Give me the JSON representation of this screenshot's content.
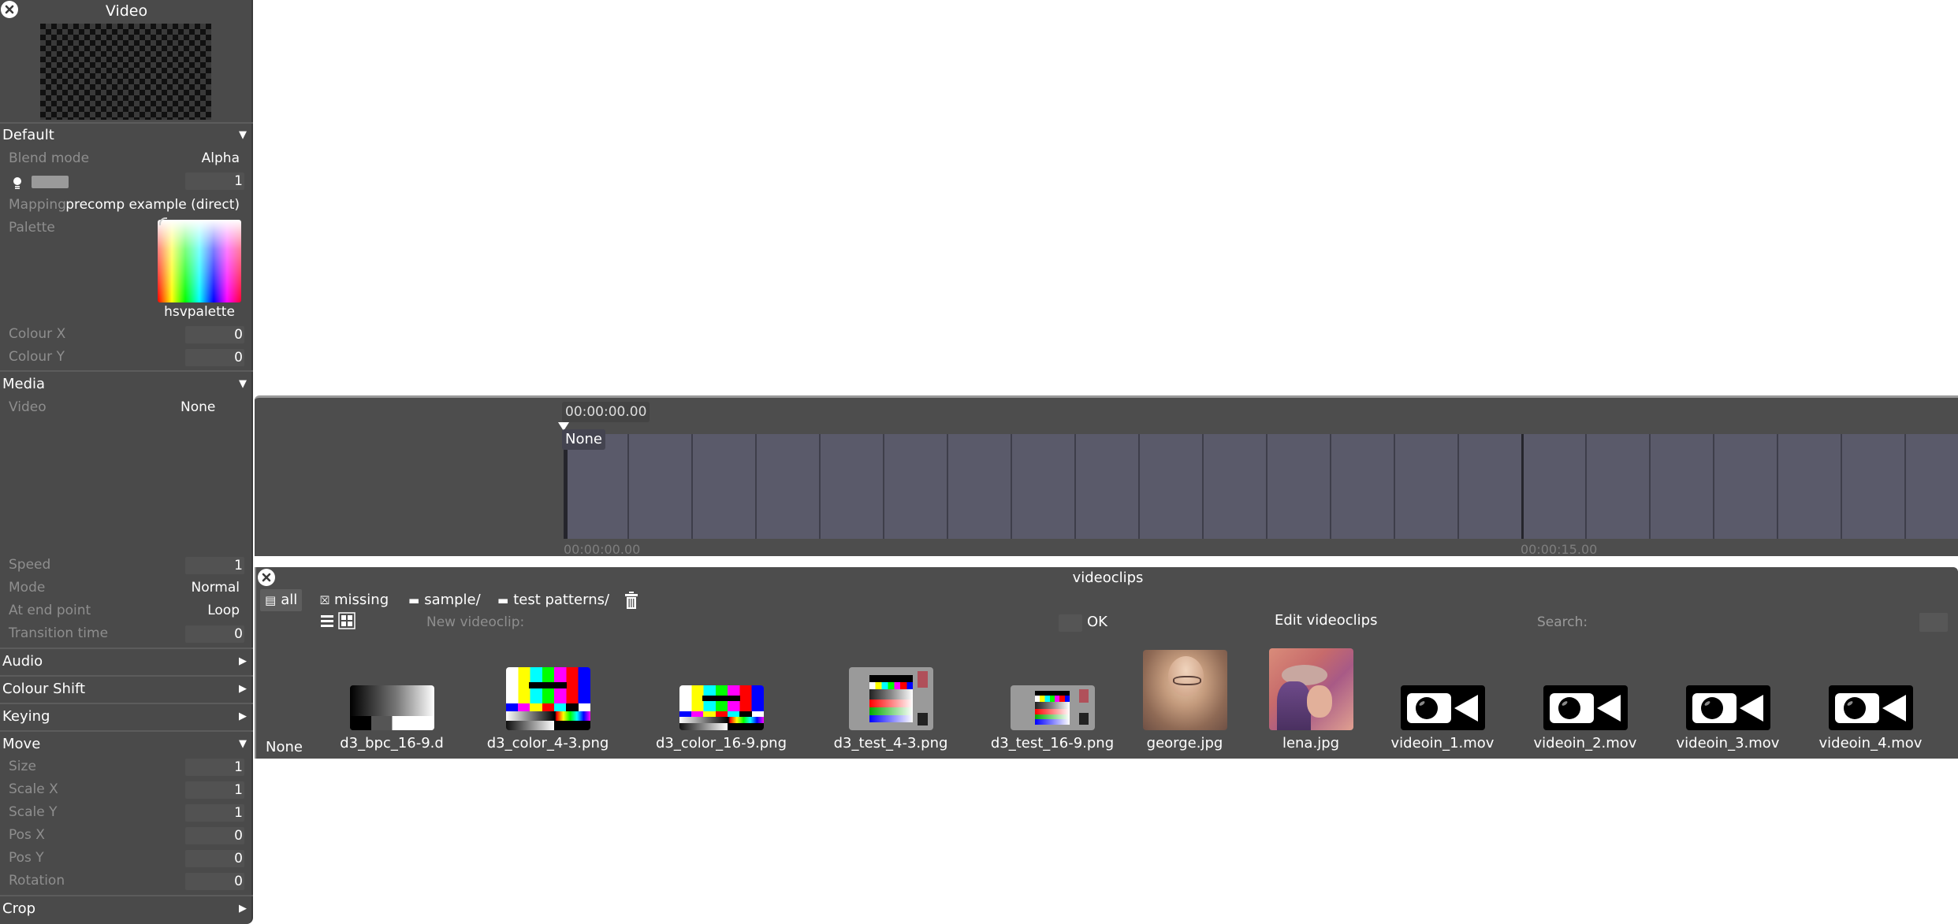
{
  "left_panel": {
    "title": "Video",
    "sections": {
      "default": {
        "label": "Default",
        "expanded": true,
        "blend_mode_label": "Blend mode",
        "blend_mode_value": "Alpha",
        "opacity_value": "1",
        "mapping_label": "Mapping",
        "mapping_value": "precomp example (direct)",
        "palette_label": "Palette",
        "palette_name": "hsvpalette",
        "colour_x_label": "Colour X",
        "colour_x_value": "0",
        "colour_y_label": "Colour Y",
        "colour_y_value": "0"
      },
      "media": {
        "label": "Media",
        "expanded": true,
        "video_label": "Video",
        "video_value": "None",
        "speed_label": "Speed",
        "speed_value": "1",
        "mode_label": "Mode",
        "mode_value": "Normal",
        "end_point_label": "At end point",
        "end_point_value": "Loop",
        "transition_label": "Transition time",
        "transition_value": "0"
      },
      "audio": {
        "label": "Audio",
        "expanded": false
      },
      "colour_shift": {
        "label": "Colour Shift",
        "expanded": false
      },
      "keying": {
        "label": "Keying",
        "expanded": false
      },
      "move": {
        "label": "Move",
        "expanded": true,
        "size_label": "Size",
        "size_value": "1",
        "scale_x_label": "Scale X",
        "scale_x_value": "1",
        "scale_y_label": "Scale Y",
        "scale_y_value": "1",
        "pos_x_label": "Pos X",
        "pos_x_value": "0",
        "pos_y_label": "Pos Y",
        "pos_y_value": "0",
        "rotation_label": "Rotation",
        "rotation_value": "0"
      },
      "crop": {
        "label": "Crop",
        "expanded": false
      }
    }
  },
  "timeline": {
    "current_time": "00:00:00.00",
    "clip_label": "None",
    "start_time": "00:00:00.00",
    "marker_time": "00:00:15.00"
  },
  "videoclips": {
    "title": "videoclips",
    "filters": [
      {
        "label": "all",
        "icon": "list-icon",
        "active": true
      },
      {
        "label": "missing",
        "icon": "missing-icon",
        "active": false
      },
      {
        "label": "sample/",
        "icon": "folder-icon",
        "active": false
      },
      {
        "label": "test patterns/",
        "icon": "folder-icon",
        "active": false
      }
    ],
    "new_clip_label": "New videoclip:",
    "ok_label": "OK",
    "edit_label": "Edit videoclips",
    "search_label": "Search:",
    "none_label": "None",
    "clips": [
      {
        "name": "d3_bpc_16-9.d",
        "type": "gradient"
      },
      {
        "name": "d3_color_4-3.png",
        "type": "colorbars"
      },
      {
        "name": "d3_color_16-9.png",
        "type": "colorbars"
      },
      {
        "name": "d3_test_4-3.png",
        "type": "testcard"
      },
      {
        "name": "d3_test_16-9.png",
        "type": "testcard"
      },
      {
        "name": "george.jpg",
        "type": "photo"
      },
      {
        "name": "lena.jpg",
        "type": "photo"
      },
      {
        "name": "videoin_1.mov",
        "type": "camera"
      },
      {
        "name": "videoin_2.mov",
        "type": "camera"
      },
      {
        "name": "videoin_3.mov",
        "type": "camera"
      },
      {
        "name": "videoin_4.mov",
        "type": "camera"
      }
    ]
  },
  "colors": {
    "panel_bg": "#4a4a4a",
    "track_bg": "#5a5a6a",
    "label_muted": "#8e8e8e",
    "text": "#ffffff"
  }
}
